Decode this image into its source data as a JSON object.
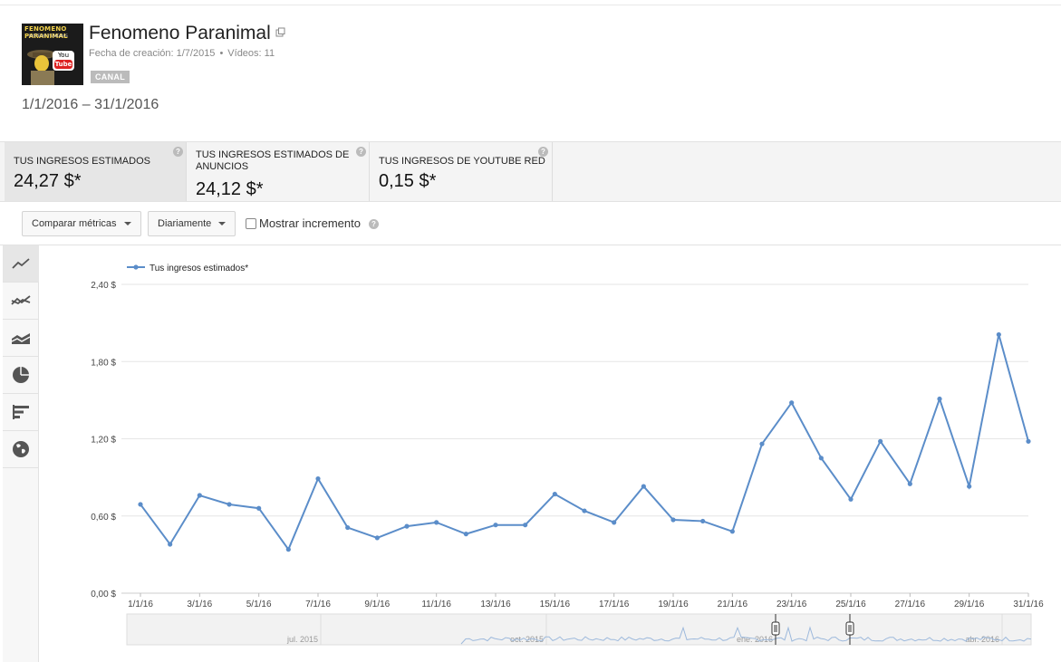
{
  "channel": {
    "name": "Fenomeno Paranimal",
    "thumb_title": "FENOMENO PARANIMAL",
    "thumb_subtitle": "MISTERIO Y ENIGMAS",
    "thumb_logo_top": "You",
    "thumb_logo_bottom": "Tube",
    "created": "Fecha de creación: 1/7/2015",
    "separator": "•",
    "videos": "Vídeos: 11",
    "badge": "CANAL"
  },
  "date_range": "1/1/2016 – 31/1/2016",
  "metric_tabs": [
    {
      "label": "Tus ingresos estimados",
      "value": "24,27 $*"
    },
    {
      "label": "Tus ingresos estimados de anuncios",
      "value": "24,12 $*"
    },
    {
      "label": "Tus ingresos de YouTube Red",
      "value": "0,15 $*"
    }
  ],
  "help_icon": "?",
  "controls": {
    "compare_label": "Comparar métricas",
    "interval_label": "Diariamente",
    "show_increment_label": "Mostrar incremento"
  },
  "sidebar_icons": [
    "line-chart-icon",
    "multi-line-chart-icon",
    "stacked-area-chart-icon",
    "pie-chart-icon",
    "bar-chart-icon",
    "globe-map-icon"
  ],
  "colors": {
    "series": "#5b8dc9",
    "accent_text": "#222"
  },
  "chart_data": {
    "type": "line",
    "title": "",
    "xlabel": "",
    "ylabel": "",
    "ylim": [
      0,
      2.4
    ],
    "yticks": [
      "0,00 $",
      "0,60 $",
      "1,20 $",
      "1,80 $",
      "2,40 $"
    ],
    "xtick_labels": [
      "1/1/16",
      "3/1/16",
      "5/1/16",
      "7/1/16",
      "9/1/16",
      "11/1/16",
      "13/1/16",
      "15/1/16",
      "17/1/16",
      "19/1/16",
      "21/1/16",
      "23/1/16",
      "25/1/16",
      "27/1/16",
      "29/1/16",
      "31/1/16"
    ],
    "grid": true,
    "legend_position": "top-left",
    "series": [
      {
        "name": "Tus ingresos estimados*",
        "x": [
          "1/1/16",
          "2/1/16",
          "3/1/16",
          "4/1/16",
          "5/1/16",
          "6/1/16",
          "7/1/16",
          "8/1/16",
          "9/1/16",
          "10/1/16",
          "11/1/16",
          "12/1/16",
          "13/1/16",
          "14/1/16",
          "15/1/16",
          "16/1/16",
          "17/1/16",
          "18/1/16",
          "19/1/16",
          "20/1/16",
          "21/1/16",
          "22/1/16",
          "23/1/16",
          "24/1/16",
          "25/1/16",
          "26/1/16",
          "27/1/16",
          "28/1/16",
          "29/1/16",
          "30/1/16",
          "31/1/16"
        ],
        "values": [
          0.69,
          0.38,
          0.76,
          0.69,
          0.66,
          0.34,
          0.89,
          0.51,
          0.43,
          0.52,
          0.55,
          0.46,
          0.53,
          0.53,
          0.77,
          0.64,
          0.55,
          0.83,
          0.57,
          0.56,
          0.48,
          1.16,
          1.48,
          1.05,
          0.73,
          1.18,
          0.85,
          1.51,
          0.83,
          2.01,
          1.18
        ]
      }
    ],
    "navigator_labels": [
      "jul. 2015",
      "oct. 2015",
      "ene. 2016",
      "abr. 2016"
    ]
  }
}
